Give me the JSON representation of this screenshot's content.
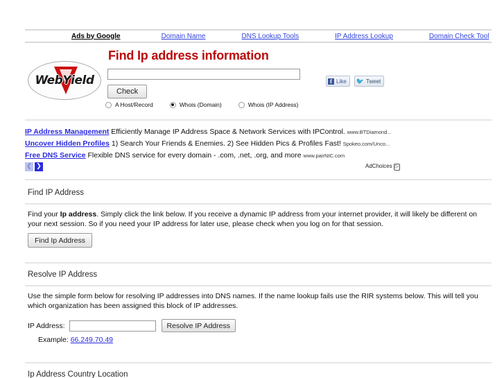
{
  "adsbar": {
    "label": "Ads by Google",
    "links": [
      "Domain Name",
      "DNS Lookup Tools",
      "IP Address Lookup",
      "Domain Check Tool"
    ]
  },
  "header": {
    "logo_text": "WebYield",
    "title": "Find Ip address information",
    "search_value": "",
    "search_placeholder": "",
    "check_label": "Check",
    "radios": [
      {
        "label": "A Host/Record",
        "selected": false
      },
      {
        "label": "Whois (Domain)",
        "selected": true
      },
      {
        "label": "Whois (IP Address)",
        "selected": false
      }
    ],
    "social": {
      "facebook_label": "Like",
      "facebook_glyph": "f",
      "twitter_label": "Tweet",
      "twitter_glyph": "ᴠ"
    }
  },
  "text_ads": {
    "items": [
      {
        "title": "IP Address Management",
        "desc": "Efficiently Manage IP Address Space & Network Services with IPControl.",
        "url": "www.BTDiamond..."
      },
      {
        "title": "Uncover Hidden Profiles",
        "desc": "1) Search Your Friends & Enemies. 2) See Hidden Pics & Profiles Fast!",
        "url": "Spokeo.com/Unco..."
      },
      {
        "title": "Free DNS Service",
        "desc": "Flexible DNS service for every domain - .com, .net, .org, and more",
        "url": "www.pairNIC.com"
      }
    ],
    "prev_arrow": "❮",
    "next_arrow": "❯",
    "adchoices_label": "AdChoices",
    "adchoices_mark": "▷"
  },
  "sections": {
    "find_ip": {
      "heading": "Find IP Address",
      "body_before": "Find your ",
      "body_bold": "Ip address",
      "body_after": ". Simply click the link below. If you receive a dynamic IP address from your internet provider, it will likely be different on your next session. So if you need your IP address for later use, please check when you log on for that session.",
      "button_label": "Find Ip Address"
    },
    "resolve_ip": {
      "heading": "Resolve IP Address",
      "body": "Use the simple form below for resolving IP addresses into DNS names. If the name lookup fails use the RIR systems below. This will tell you which organization has been assigned this block of IP addresses.",
      "field_label": "IP Address:",
      "field_value": "",
      "field_placeholder": "",
      "button_label": "Resolve IP Address",
      "example_label": "Example:",
      "example_link": "66.249.70.49"
    },
    "country_location": {
      "heading": "Ip Address Country Location"
    }
  },
  "colors": {
    "title_red": "#bb0a0a",
    "link_blue": "#2b2be0",
    "rule_gray": "#e6e6e6"
  }
}
